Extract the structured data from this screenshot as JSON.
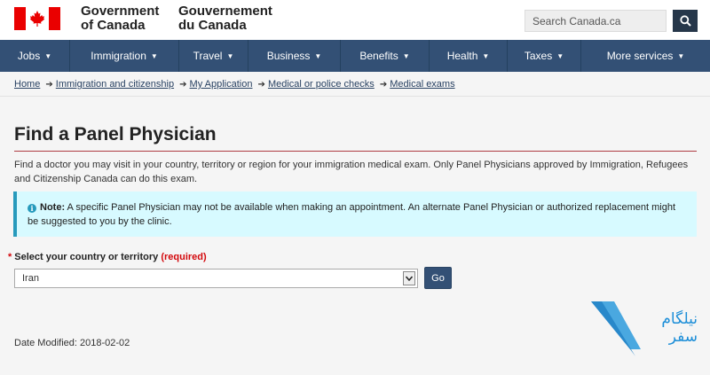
{
  "header": {
    "gov_en_line1": "Government",
    "gov_en_line2": "of Canada",
    "gov_fr_line1": "Gouvernement",
    "gov_fr_line2": "du Canada",
    "flag_icon": "canada-flag-icon",
    "search": {
      "placeholder": "Search Canada.ca",
      "button_icon": "search-icon"
    }
  },
  "nav": {
    "items": [
      {
        "label": "Jobs"
      },
      {
        "label": "Immigration"
      },
      {
        "label": "Travel"
      },
      {
        "label": "Business"
      },
      {
        "label": "Benefits"
      },
      {
        "label": "Health"
      },
      {
        "label": "Taxes"
      },
      {
        "label": "More services"
      }
    ]
  },
  "breadcrumb": [
    {
      "label": "Home"
    },
    {
      "label": "Immigration and citizenship"
    },
    {
      "label": "My Application"
    },
    {
      "label": "Medical or police checks"
    },
    {
      "label": "Medical exams"
    }
  ],
  "page": {
    "title": "Find a Panel Physician",
    "intro": "Find a doctor you may visit in your country, territory or region for your immigration medical exam. Only Panel Physicians approved by Immigration, Refugees and Citizenship Canada can do this exam.",
    "note_label": "Note:",
    "note_text": " A specific Panel Physician may not be available when making an appointment. An alternate Panel Physician or authorized replacement might be suggested to you by the clinic.",
    "form": {
      "label": "Select your country or territory",
      "required": "(required)",
      "selected_value": "Iran",
      "go_label": "Go"
    },
    "date_modified": "Date Modified: 2018-02-02"
  },
  "watermark": {
    "line1": "نیلگام",
    "line2": "سفر"
  },
  "colors": {
    "nav_bg": "#335075",
    "header_btn": "#26374a",
    "title_rule": "#af3c43",
    "note_bg": "#d7faff",
    "note_border": "#269abc",
    "required": "#d3080c"
  }
}
